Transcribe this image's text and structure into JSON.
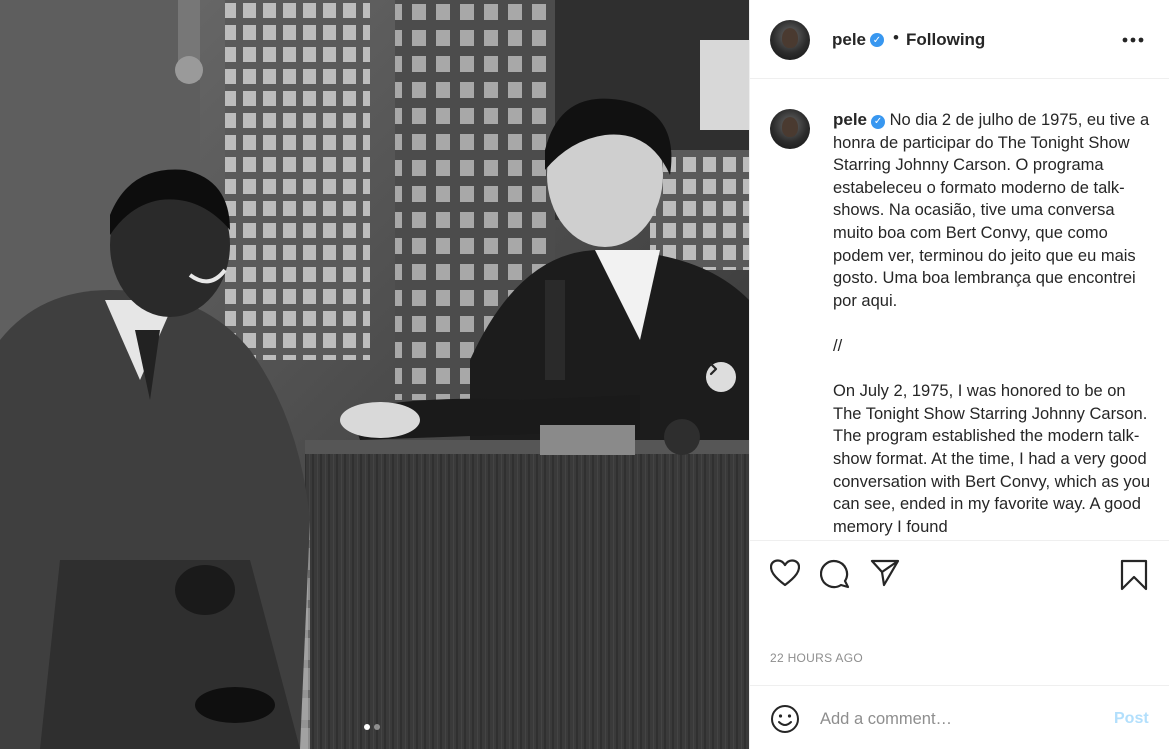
{
  "post": {
    "username": "pele",
    "verified": true,
    "separator": "•",
    "follow_status": "Following",
    "more_icon": "more-horizontal-icon",
    "caption_pt": "No dia 2 de julho de 1975, eu tive a honra de participar do The Tonight Show Starring Johnny Carson. O programa estabeleceu o formato moderno de talk-shows. Na ocasião, tive uma conversa muito boa com Bert Convy, que como podem ver, terminou do jeito que eu mais gosto. Uma boa lembrança que encontrei por aqui.",
    "caption_divider": "//",
    "caption_en": "On July 2, 1975, I was honored to be on The Tonight Show Starring Johnny Carson. The program established the modern talk-show format. At the time, I had a very good conversation with Bert Convy, which as you can see, ended in my favorite way. A good memory I found",
    "timestamp": "22 HOURS AGO"
  },
  "carousel": {
    "current_slide": 1,
    "total_slides": 2,
    "next_icon": "chevron-right-icon"
  },
  "actions": {
    "like_icon": "heart-icon",
    "comment_icon": "comment-icon",
    "share_icon": "paper-plane-icon",
    "save_icon": "bookmark-icon"
  },
  "comment": {
    "emoji_icon": "smiley-icon",
    "placeholder": "Add a comment…",
    "post_label": "Post"
  },
  "colors": {
    "verified_blue": "#3897f0",
    "post_button_disabled": "#b2dffc",
    "muted_text": "#8e8e8e",
    "border": "#efefef"
  }
}
